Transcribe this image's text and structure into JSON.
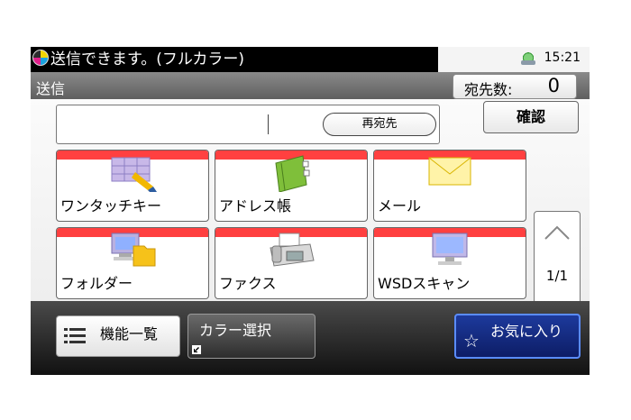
{
  "status": {
    "message": "送信できます。(フルカラー)",
    "time": "15:21"
  },
  "title": {
    "label": "送信",
    "dest_label": "宛先数:",
    "dest_count": "0"
  },
  "address": {
    "redial_label": "再宛先",
    "confirm_label": "確認"
  },
  "tiles": [
    {
      "label": "ワンタッチキー",
      "icon": "one-touch-key-icon"
    },
    {
      "label": "アドレス帳",
      "icon": "address-book-icon"
    },
    {
      "label": "メール",
      "icon": "mail-icon"
    },
    {
      "label": "フォルダー",
      "icon": "folder-icon"
    },
    {
      "label": "ファクス",
      "icon": "fax-icon"
    },
    {
      "label": "WSDスキャン",
      "icon": "wsd-scan-icon"
    }
  ],
  "pager": {
    "page": "1/1"
  },
  "bottom": {
    "functions_label": "機能一覧",
    "color_select_label": "カラー選択",
    "favorites_label": "お気に入り"
  },
  "colors": {
    "accent_red": "#ff4040",
    "favorite_blue": "#1d3a9c"
  }
}
